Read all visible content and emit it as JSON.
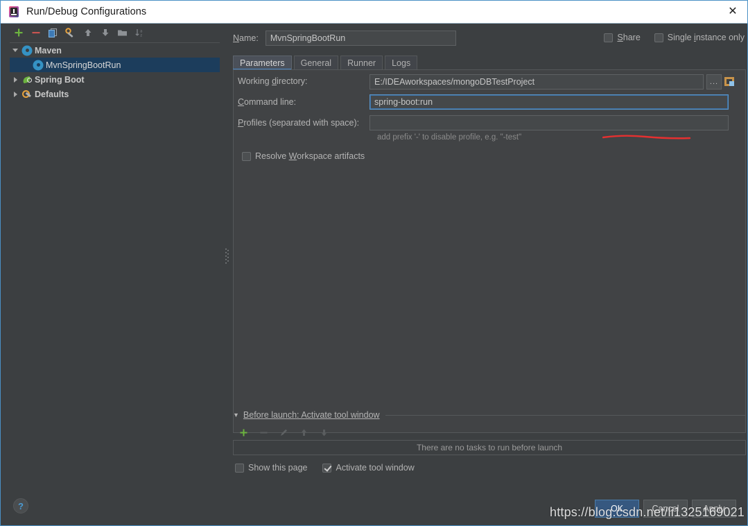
{
  "window": {
    "title": "Run/Debug Configurations",
    "app_icon": "intellij-idea-icon",
    "close_label": "✕"
  },
  "left_panel": {
    "toolbar": [
      {
        "name": "add-configuration-button",
        "glyph": "+",
        "label": "Add New Configuration"
      },
      {
        "name": "remove-configuration-button",
        "glyph": "−",
        "label": "Remove Configuration"
      },
      {
        "name": "copy-configuration-button",
        "glyph": "copy-icon",
        "label": "Copy Configuration"
      },
      {
        "name": "edit-defaults-button",
        "glyph": "wrench-icon",
        "label": "Edit Defaults"
      },
      {
        "name": "move-up-button",
        "glyph": "↑",
        "label": "Move Up"
      },
      {
        "name": "move-down-button",
        "glyph": "↓",
        "label": "Move Down"
      },
      {
        "name": "create-folder-button",
        "glyph": "folder-icon",
        "label": "Create New Folder"
      },
      {
        "name": "sort-configurations-button",
        "glyph": "sort-az-icon",
        "label": "Sort Configurations"
      }
    ],
    "tree": [
      {
        "label": "Maven",
        "icon": "maven-gear-icon",
        "expanded": true,
        "type": "group",
        "selected": false,
        "indent": 0
      },
      {
        "label": "MvnSpringBootRun",
        "icon": "maven-gear-icon",
        "expanded": null,
        "type": "item",
        "selected": true,
        "indent": 1
      },
      {
        "label": "Spring Boot",
        "icon": "spring-boot-leaf-icon",
        "expanded": false,
        "type": "group",
        "selected": false,
        "indent": 0
      },
      {
        "label": "Defaults",
        "icon": "defaults-wrench-icon",
        "expanded": false,
        "type": "group",
        "selected": false,
        "indent": 0
      }
    ]
  },
  "main": {
    "name_label": "Name:",
    "name_value": "MvnSpringBootRun",
    "share": {
      "label": "Share",
      "checked": false
    },
    "single_instance": {
      "label": "Single instance only",
      "checked": false
    },
    "tabs": [
      {
        "label": "Parameters",
        "active": true
      },
      {
        "label": "General",
        "active": false
      },
      {
        "label": "Runner",
        "active": false
      },
      {
        "label": "Logs",
        "active": false
      }
    ],
    "parameters": {
      "working_directory_label": "Working directory:",
      "working_directory_value": "E:/IDEAworkspaces/mongoDBTestProject",
      "browse_button_label": "...",
      "module_button_name": "module-folder-icon",
      "command_line_label": "Command line:",
      "command_line_value": "spring-boot:run",
      "profiles_label": "Profiles (separated with space):",
      "profiles_value": "",
      "profiles_hint": "add prefix '-' to disable profile, e.g. \"-test\"",
      "resolve_workspace": {
        "label": "Resolve Workspace artifacts",
        "checked": false
      }
    },
    "before_launch": {
      "header": "Before launch: Activate tool window",
      "toolbar": [
        {
          "name": "bl-add-task-button",
          "glyph": "+"
        },
        {
          "name": "bl-remove-task-button",
          "glyph": "−"
        },
        {
          "name": "bl-edit-task-button",
          "glyph": "pencil-icon"
        },
        {
          "name": "bl-move-up-button",
          "glyph": "↑"
        },
        {
          "name": "bl-move-down-button",
          "glyph": "↓"
        }
      ],
      "empty_text": "There are no tasks to run before launch",
      "show_page": {
        "label": "Show this page",
        "checked": false
      },
      "activate_tool_window": {
        "label": "Activate tool window",
        "checked": true
      }
    }
  },
  "footer": {
    "help_label": "?",
    "ok_label": "OK",
    "cancel_label": "Cancel",
    "apply_label": "Apply"
  },
  "watermark": "https://blog.csdn.net/li1325169021",
  "colors": {
    "dialog_bg": "#3c3f41",
    "panel_bg": "#414345",
    "accent_blue": "#4a88c7",
    "selection_blue": "#1c3d5c",
    "primary_button": "#365880",
    "annotation_red": "#e53030",
    "add_green": "#6cb33f",
    "remove_red": "#c75450",
    "text": "#b4b4b4"
  }
}
